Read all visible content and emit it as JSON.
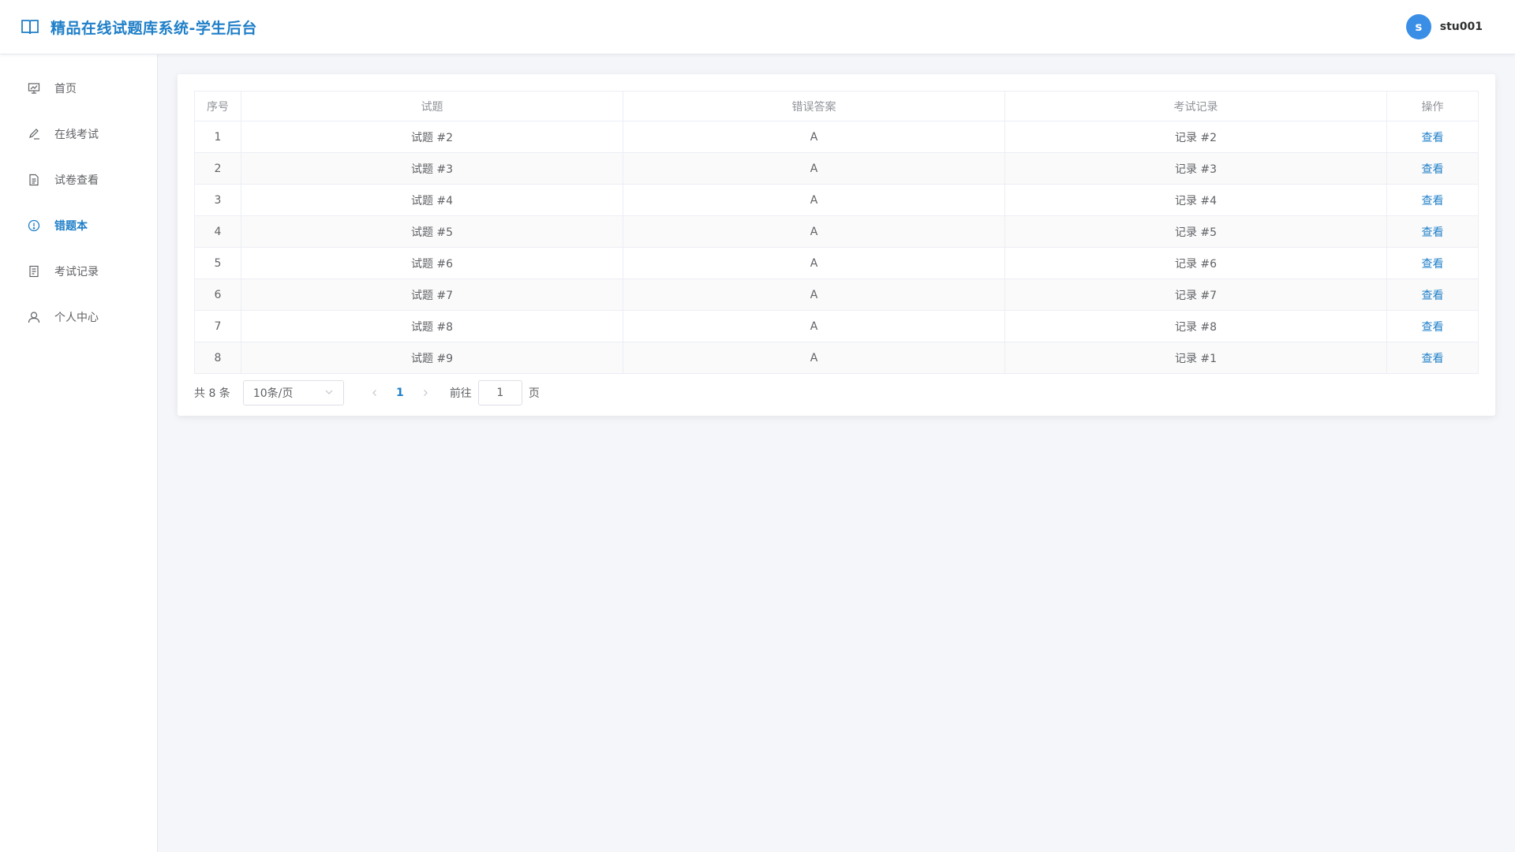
{
  "header": {
    "title": "精品在线试题库系统-学生后台",
    "brand_icon": "book-icon",
    "avatar_letter": "s",
    "username": "stu001"
  },
  "colors": {
    "accent": "#1f7fc8",
    "avatar": "#3a8ee6",
    "background": "#f5f6fa"
  },
  "sidebar": {
    "items": [
      {
        "label": "首页",
        "icon": "presentation-icon",
        "active": false
      },
      {
        "label": "在线考试",
        "icon": "edit-icon",
        "active": false
      },
      {
        "label": "试卷查看",
        "icon": "document-icon",
        "active": false
      },
      {
        "label": "错题本",
        "icon": "warning-circle-icon",
        "active": true
      },
      {
        "label": "考试记录",
        "icon": "tickets-icon",
        "active": false
      },
      {
        "label": "个人中心",
        "icon": "user-icon",
        "active": false
      }
    ]
  },
  "table": {
    "headers": [
      "序号",
      "试题",
      "错误答案",
      "考试记录",
      "操作"
    ],
    "rows": [
      {
        "index": "1",
        "question": "试题 #2",
        "wrong_answer": "A",
        "record": "记录 #2",
        "action": "查看"
      },
      {
        "index": "2",
        "question": "试题 #3",
        "wrong_answer": "A",
        "record": "记录 #3",
        "action": "查看"
      },
      {
        "index": "3",
        "question": "试题 #4",
        "wrong_answer": "A",
        "record": "记录 #4",
        "action": "查看"
      },
      {
        "index": "4",
        "question": "试题 #5",
        "wrong_answer": "A",
        "record": "记录 #5",
        "action": "查看"
      },
      {
        "index": "5",
        "question": "试题 #6",
        "wrong_answer": "A",
        "record": "记录 #6",
        "action": "查看"
      },
      {
        "index": "6",
        "question": "试题 #7",
        "wrong_answer": "A",
        "record": "记录 #7",
        "action": "查看"
      },
      {
        "index": "7",
        "question": "试题 #8",
        "wrong_answer": "A",
        "record": "记录 #8",
        "action": "查看"
      },
      {
        "index": "8",
        "question": "试题 #9",
        "wrong_answer": "A",
        "record": "记录 #1",
        "action": "查看"
      }
    ]
  },
  "pagination": {
    "total_text": "共 8 条",
    "page_size": "10条/页",
    "current_page": "1",
    "goto_label": "前往",
    "goto_value": "1",
    "page_suffix": "页"
  }
}
